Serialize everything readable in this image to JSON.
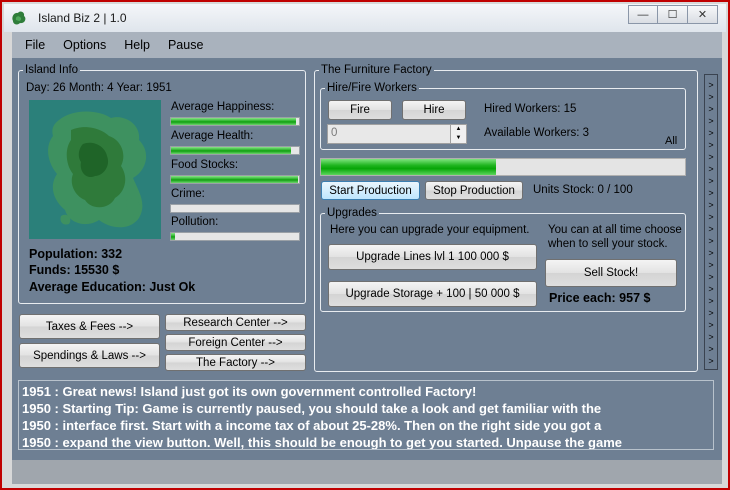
{
  "window": {
    "title": "Island Biz 2 | 1.0",
    "controls": [
      "—",
      "☐",
      "✕"
    ]
  },
  "menu": [
    "File",
    "Options",
    "Help",
    "Pause"
  ],
  "island_info": {
    "legend": "Island Info",
    "date": "Day: 26 Month: 4 Year: 1951",
    "stats": [
      {
        "label": "Average Happiness:",
        "level": 0.98
      },
      {
        "label": "Average Health:",
        "level": 0.94
      },
      {
        "label": "Food Stocks:",
        "level": 0.99
      },
      {
        "label": "Crime:",
        "level": 0.0
      },
      {
        "label": "Pollution:",
        "level": 0.03
      }
    ],
    "population": "Population: 332",
    "funds": "Funds: 15530 $",
    "education": "Average Education: Just Ok"
  },
  "nav_buttons": {
    "taxes": "Taxes & Fees -->",
    "spendings": "Spendings & Laws -->",
    "research": "Research Center -->",
    "foreign": "Foreign Center -->",
    "factory": "The Factory -->"
  },
  "factory": {
    "legend": "The Furniture Factory",
    "workers": {
      "legend": "Hire/Fire Workers",
      "fire": "Fire",
      "hire": "Hire",
      "amount": "0",
      "hired": "Hired Workers: 15",
      "available": "Available Workers: 3",
      "all": "All"
    },
    "production_level": 0.48,
    "start": "Start Production",
    "stop": "Stop Production",
    "units_stock": "Units Stock: 0 / 100",
    "upgrades": {
      "legend": "Upgrades",
      "hint": "Here you can upgrade your equipment.",
      "lines": "Upgrade Lines lvl 1 100 000 $",
      "storage": "Upgrade Storage + 100 | 50 000 $",
      "sell_hint_1": "You can at all time choose",
      "sell_hint_2": "when to sell your stock.",
      "sell": "Sell Stock!",
      "price": "Price each: 957 $"
    }
  },
  "expand_glyph": ">",
  "log": [
    "1951 : Great news! Island just got its own government controlled Factory!",
    "1950 : Starting Tip: Game is currently paused, you should take a look and get familiar with the",
    "1950 : interface first. Start with a income tax of about 25-28%. Then on the right side you got a",
    "1950 : expand the view button. Well, this should be enough to get you started. Unpause the game"
  ],
  "colors": {
    "client_bg": "#6e7f93",
    "bar_green": "#0f9d0f",
    "frame": "#c00000"
  }
}
